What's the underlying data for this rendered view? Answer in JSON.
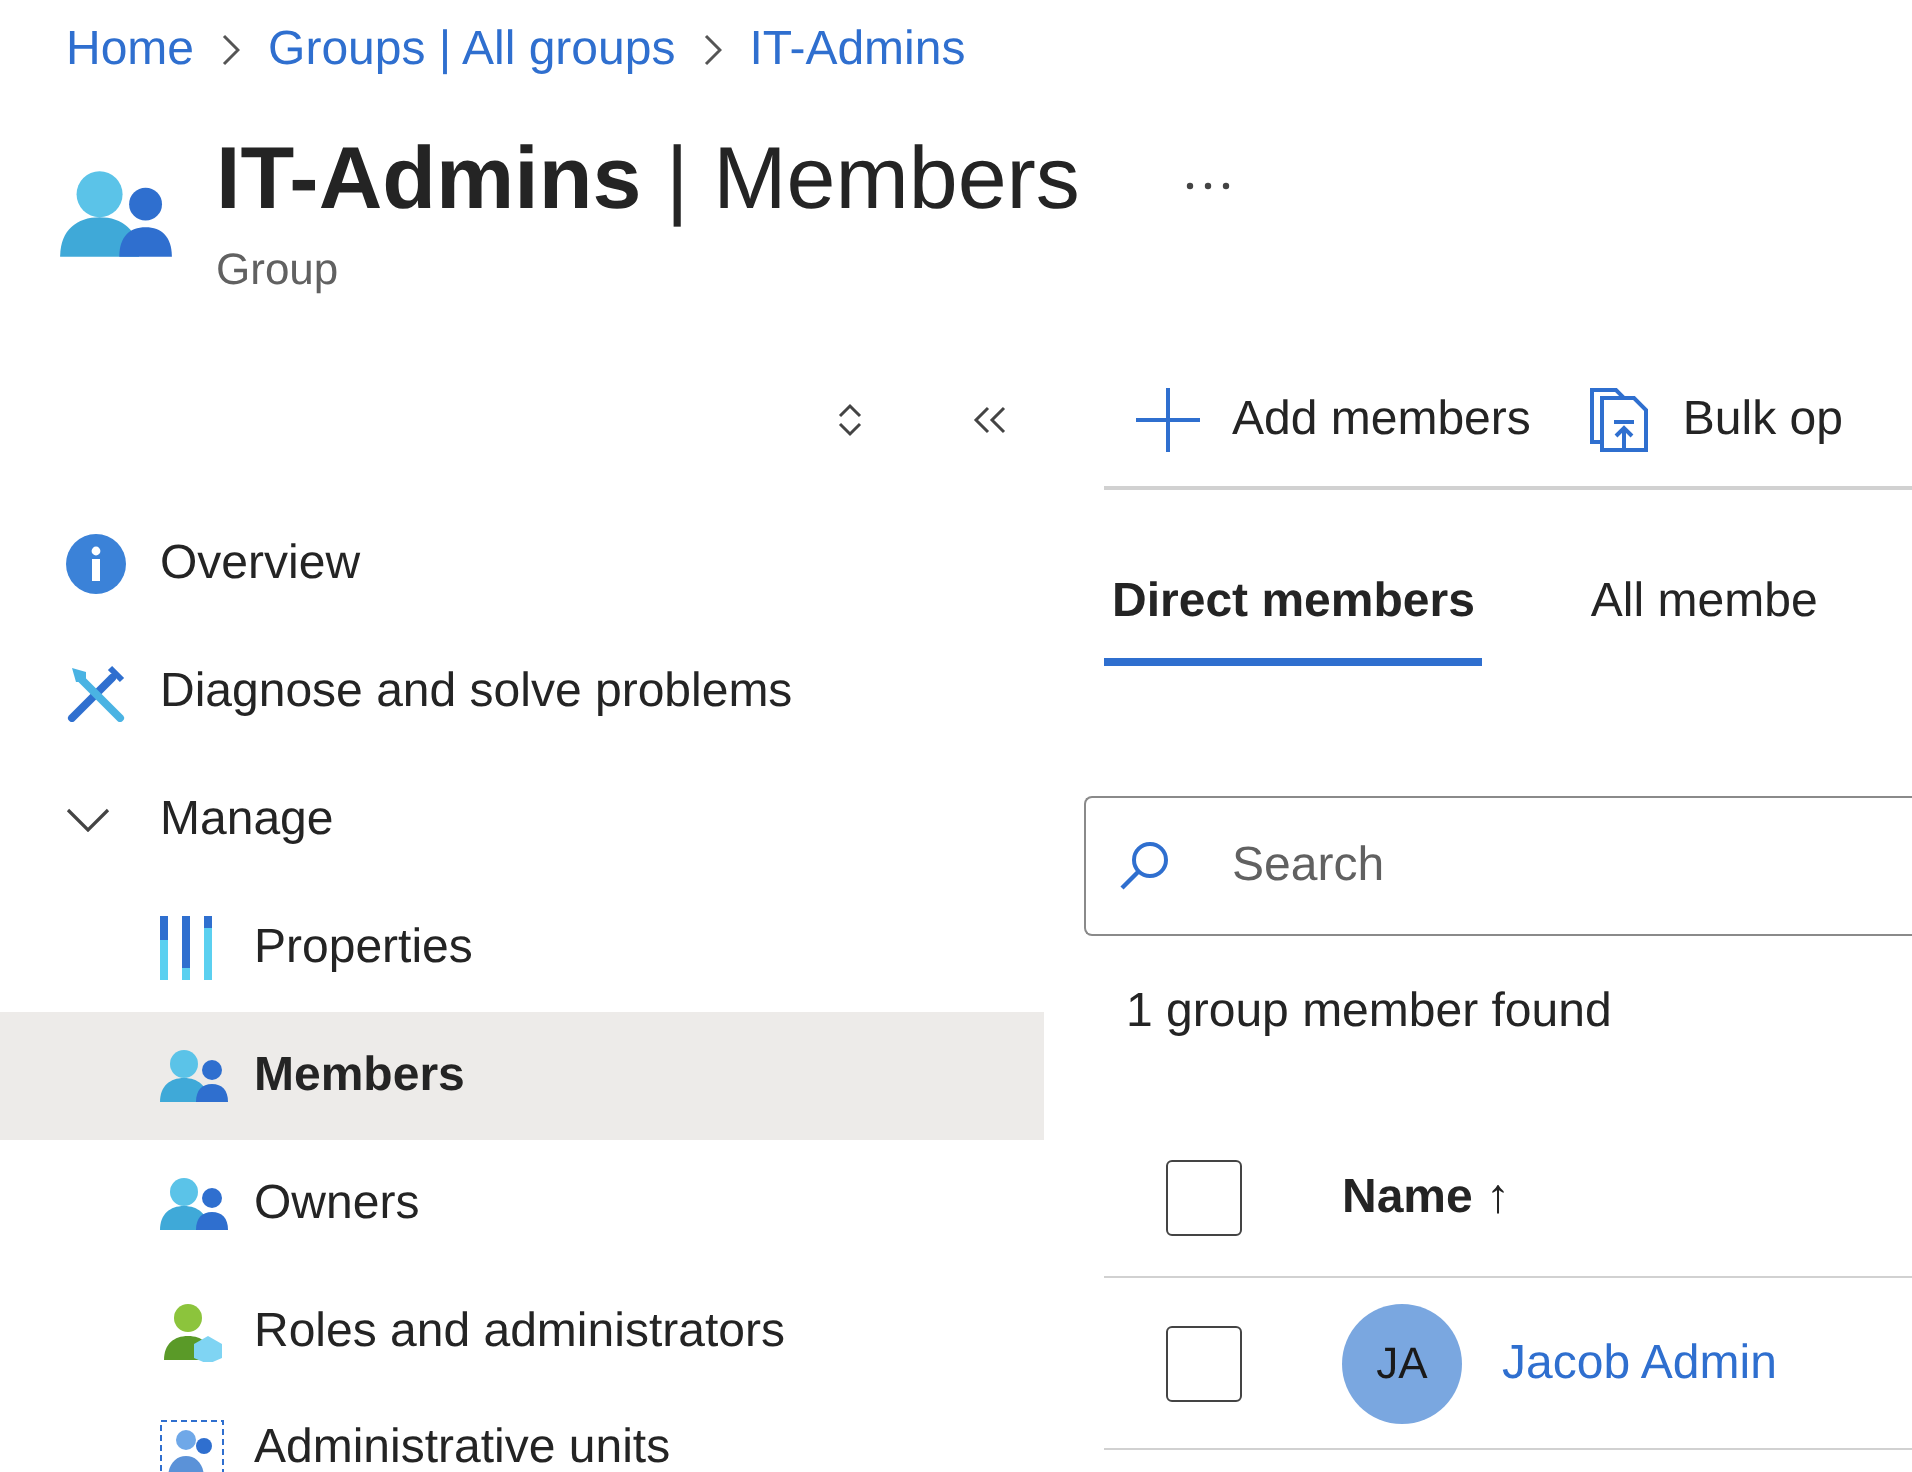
{
  "breadcrumb": [
    {
      "label": "Home"
    },
    {
      "label": "Groups | All groups"
    },
    {
      "label": "IT-Admins"
    }
  ],
  "header": {
    "title": "**IT-Admins** | Members",
    "subtitle": "Group"
  },
  "sidebar": {
    "items": [
      {
        "label": "Overview",
        "selected": false
      },
      {
        "label": "Diagnose and solve problems",
        "selected": false
      },
      {
        "label": "Manage",
        "expanded": true,
        "children": [
          {
            "label": "Properties",
            "selected": false
          },
          {
            "label": "Members",
            "selected": true
          },
          {
            "label": "Owners",
            "selected": false
          },
          {
            "label": "Roles and administrators",
            "selected": false
          },
          {
            "label": "Administrative units",
            "selected": false
          }
        ]
      }
    ]
  },
  "toolbar": [
    {
      "label": "Add members"
    },
    {
      "label": "Bulk op"
    }
  ],
  "tabs": [
    {
      "label": "Direct members",
      "selected": true
    },
    {
      "label": "All membe",
      "selected": false
    }
  ],
  "search": {
    "placeholder": "Search"
  },
  "result_count": "1 group member found",
  "table": {
    "select_all_checked": false,
    "columns": [
      {
        "label": "Name",
        "sort_indicator": "↑"
      }
    ],
    "rows": [
      {
        "initials": "JA",
        "name": "Jacob Admin",
        "checked": false
      }
    ]
  }
}
